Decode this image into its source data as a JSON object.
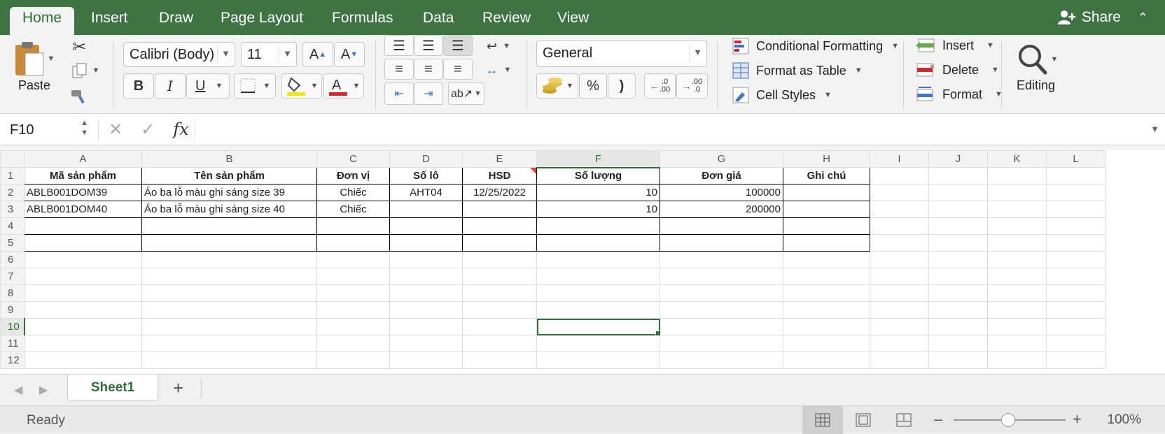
{
  "tabs": [
    "Home",
    "Insert",
    "Draw",
    "Page Layout",
    "Formulas",
    "Data",
    "Review",
    "View"
  ],
  "share_label": "Share",
  "ribbon": {
    "paste_label": "Paste",
    "font_name": "Calibri (Body)",
    "font_size": "11",
    "bold": "B",
    "italic": "I",
    "underline": "U",
    "number_format": "General",
    "percent": "%",
    "comma": ")",
    "inc_decimal": ".0\n.00",
    "dec_decimal": ".00\n.0",
    "conditional_formatting": "Conditional Formatting",
    "format_as_table": "Format as Table",
    "cell_styles": "Cell Styles",
    "insert": "Insert",
    "delete": "Delete",
    "format": "Format",
    "editing": "Editing"
  },
  "formula_bar": {
    "name_box": "F10",
    "fx": "fx",
    "value": ""
  },
  "grid": {
    "columns": [
      "A",
      "B",
      "C",
      "D",
      "E",
      "F",
      "G",
      "H",
      "I",
      "J",
      "K",
      "L"
    ],
    "rows": [
      "1",
      "2",
      "3",
      "4",
      "5",
      "6",
      "7",
      "8",
      "9",
      "10",
      "11",
      "12"
    ],
    "header_row": [
      "Mã sản phẩm",
      "Tên sản phẩm",
      "Đơn vị",
      "Số lô",
      "HSD",
      "Số lượng",
      "Đơn giá",
      "Ghi chú"
    ],
    "row2": [
      "ABLB001DOM39",
      "Áo ba lỗ màu ghi sáng size 39",
      "Chiếc",
      "AHT04",
      "12/25/2022",
      "10",
      "100000",
      ""
    ],
    "row3": [
      "ABLB001DOM40",
      "Áo ba lỗ màu ghi sáng size 40",
      "Chiếc",
      "",
      "",
      "10",
      "200000",
      ""
    ]
  },
  "sheets": [
    "Sheet1"
  ],
  "status": {
    "ready": "Ready",
    "zoom": "100%"
  },
  "colors": {
    "accent": "#3e7344",
    "selection": "#2f6e35",
    "note_marker": "#e0423b"
  }
}
